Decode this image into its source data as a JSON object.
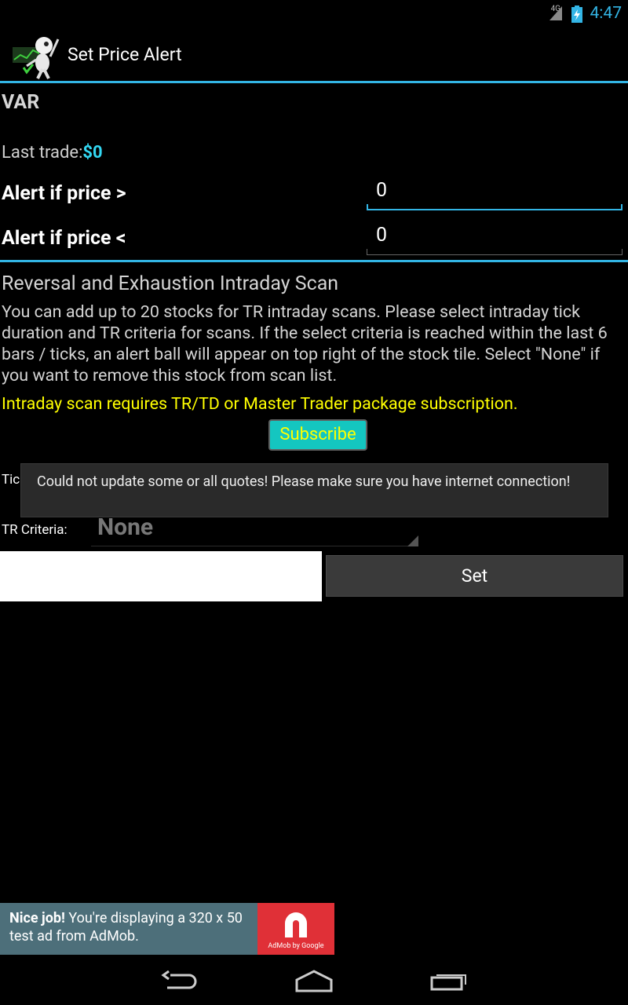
{
  "status_bar": {
    "network": "4G",
    "time": "4:47"
  },
  "action_bar": {
    "title": "Set Price Alert"
  },
  "stock": {
    "symbol": "VAR",
    "last_trade_label": "Last trade:",
    "last_trade_value": "$0"
  },
  "alerts": {
    "above_label": "Alert if price >",
    "above_value": "0",
    "below_label": "Alert if price <",
    "below_value": "0"
  },
  "scan": {
    "title": "Reversal and Exhaustion Intraday Scan",
    "description": "You can add up to 20 stocks for TR intraday scans. Please select intraday tick duration and TR criteria for scans. If the select criteria is reached within the last 6 bars / ticks, an alert ball will appear on top right of the stock tile. Select \"None\" if you want to remove this stock from scan list.",
    "requirement_note": "Intraday scan requires TR/TD or Master Trader package subscription.",
    "subscribe_label": "Subscribe",
    "tick_label": "Tick",
    "tr_criteria_label": "TR Criteria:",
    "tr_criteria_value": "None"
  },
  "toast": {
    "message": "Could not update some or all quotes! Please make sure you have internet connection!"
  },
  "actions": {
    "set_label": "Set"
  },
  "ad": {
    "bold_text": "Nice job!",
    "text": " You're displaying a 320 x 50 test ad from AdMob.",
    "logo_caption": "AdMob by Google"
  },
  "colors": {
    "accent": "#33b5e5",
    "value_cyan": "#33d7f2",
    "note_yellow": "#ffff00",
    "subscribe_bg": "#14c6c0",
    "ad_bg": "#4d6f7a",
    "admob_red": "#e03037"
  },
  "icons": {
    "app": "trader-robot-icon",
    "back": "back-icon",
    "home": "home-icon",
    "recents": "recents-icon"
  }
}
